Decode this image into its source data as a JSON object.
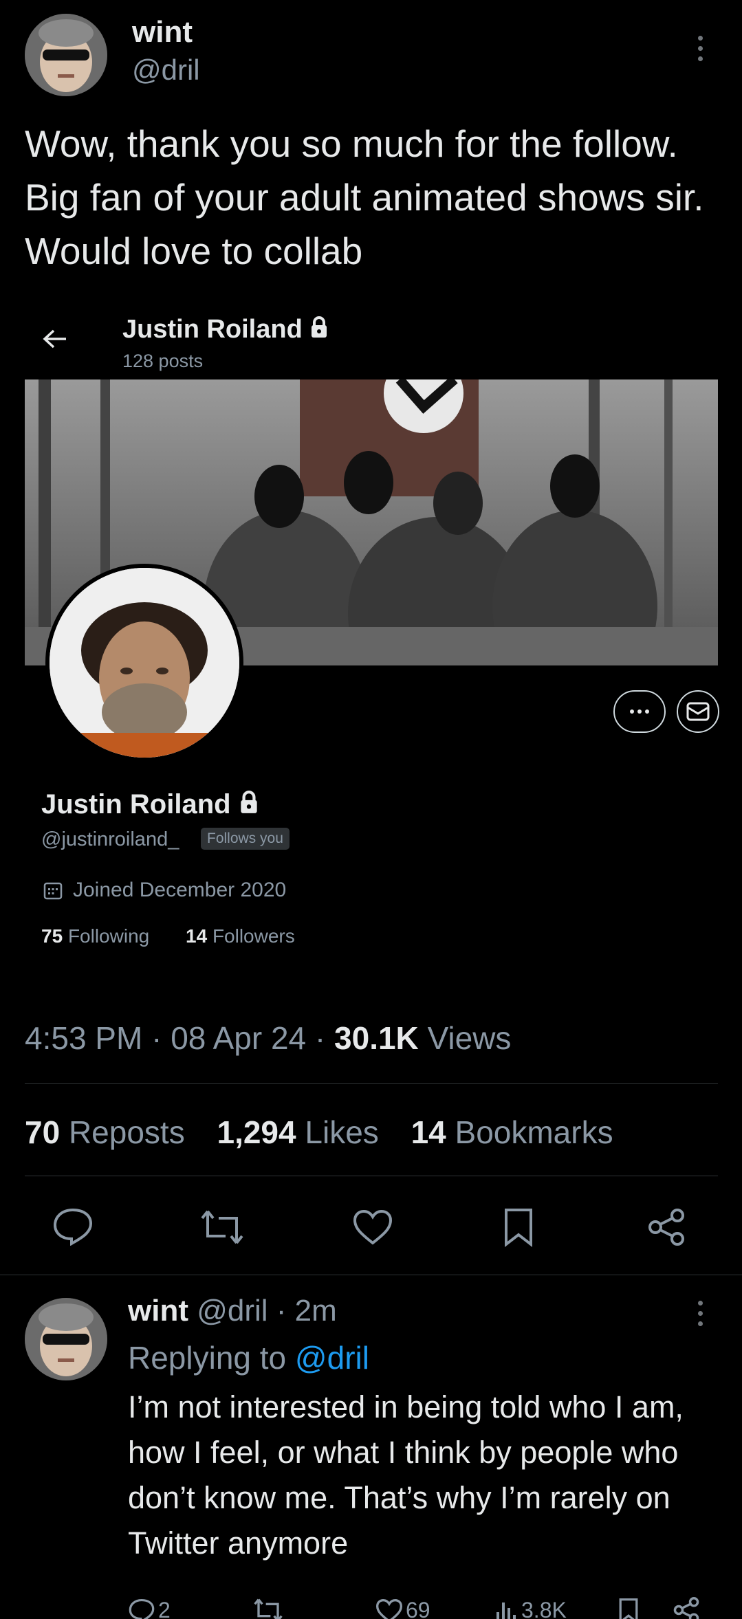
{
  "tweet": {
    "author_name": "wint",
    "author_handle": "@dril",
    "text": "Wow, thank you so much for the follow. Big fan of your adult animated shows sir. Would love to collab",
    "time": "4:53 PM",
    "date": "08 Apr 24",
    "views_count": "30.1K",
    "views_label": "Views",
    "reposts_count": "70",
    "reposts_label": "Reposts",
    "likes_count": "1,294",
    "likes_label": "Likes",
    "bookmarks_count": "14",
    "bookmarks_label": "Bookmarks"
  },
  "embedded_profile": {
    "header_name": "Justin Roiland",
    "posts": "128 posts",
    "name": "Justin Roiland",
    "handle": "@justinroiland_",
    "follows_badge": "Follows you",
    "joined": "Joined December 2020",
    "following_count": "75",
    "following_label": "Following",
    "followers_count": "14",
    "followers_label": "Followers"
  },
  "reply": {
    "author_name": "wint",
    "author_handle": "@dril",
    "time_ago": "2m",
    "replying_label": "Replying to",
    "replying_handle": "@dril",
    "text": "I’m not interested in being told who I am, how I feel, or what I think by people who don’t know me. That’s why I’m rarely on Twitter anymore",
    "reply_count": "2",
    "like_count": "69",
    "view_count": "3.8K"
  },
  "icons": {
    "more": "more-vertical-icon",
    "back": "arrow-left-icon",
    "lock": "lock-icon",
    "calendar": "calendar-icon",
    "message": "message-icon",
    "reply": "reply-icon",
    "repost": "repost-icon",
    "like": "heart-icon",
    "bookmark": "bookmark-icon",
    "share": "share-icon",
    "views": "views-icon"
  },
  "colors": {
    "background": "#000000",
    "text": "#e7e9ea",
    "muted": "#8b98a5",
    "link": "#1d9bf0",
    "divider": "#2f3336"
  }
}
